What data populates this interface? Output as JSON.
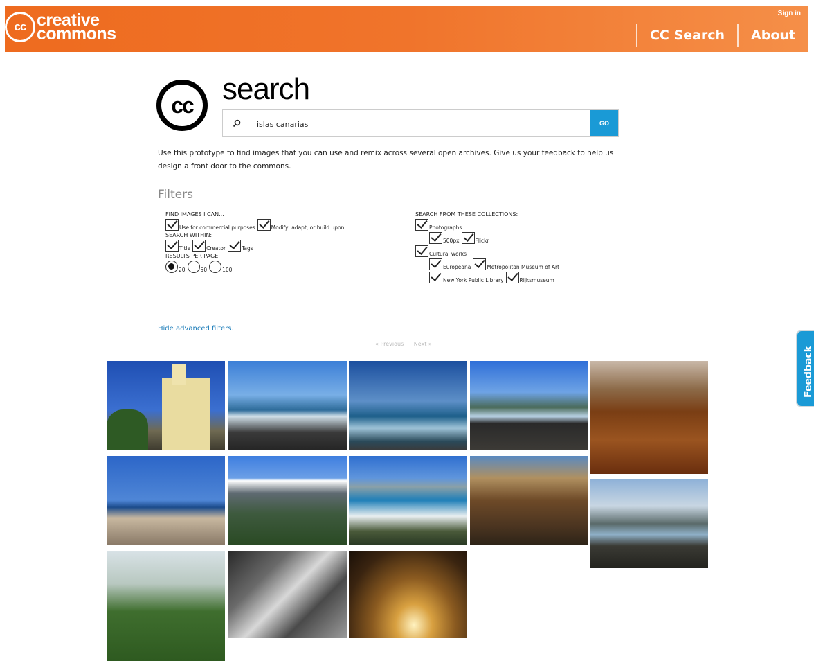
{
  "header": {
    "logo_mark": "cc",
    "logo_line1": "creative",
    "logo_line2": "commons",
    "sign_in": "Sign in",
    "nav": [
      "CC Search",
      "About"
    ]
  },
  "search": {
    "logo_mark": "cc",
    "title": "search",
    "query": "islas canarias",
    "search_icon": "magnifier-icon",
    "go_label": "GO"
  },
  "intro": "Use this prototype to find images that you can use and remix across several open archives. Give us your feedback to help us design a front door to the commons.",
  "filters": {
    "title": "Filters",
    "find_images_heading": "FIND IMAGES I CAN...",
    "find_images": [
      "Use for commercial purposes",
      "Modify, adapt, or build upon"
    ],
    "search_within_heading": "SEARCH WITHIN:",
    "search_within": [
      "Title",
      "Creator",
      "Tags"
    ],
    "results_heading": "RESULTS PER PAGE:",
    "results_options": [
      "20",
      "50",
      "100"
    ],
    "results_selected": "20",
    "collections_heading": "SEARCH FROM THESE COLLECTIONS:",
    "photographs": "Photographs",
    "photo_sources": [
      "500px",
      "Flickr"
    ],
    "cultural": "Cultural works",
    "cultural_sources": [
      "Europeana",
      "Metropolitan Museum of Art",
      "New York Public Library",
      "Rijksmuseum"
    ]
  },
  "hide_filters": "Hide advanced filters.",
  "pager": {
    "previous": "« Previous",
    "next": "Next »"
  },
  "feedback": "Feedback",
  "colors": {
    "header": "#ee6b1f",
    "accent": "#1a9ad6",
    "link": "#1a7bb8"
  }
}
